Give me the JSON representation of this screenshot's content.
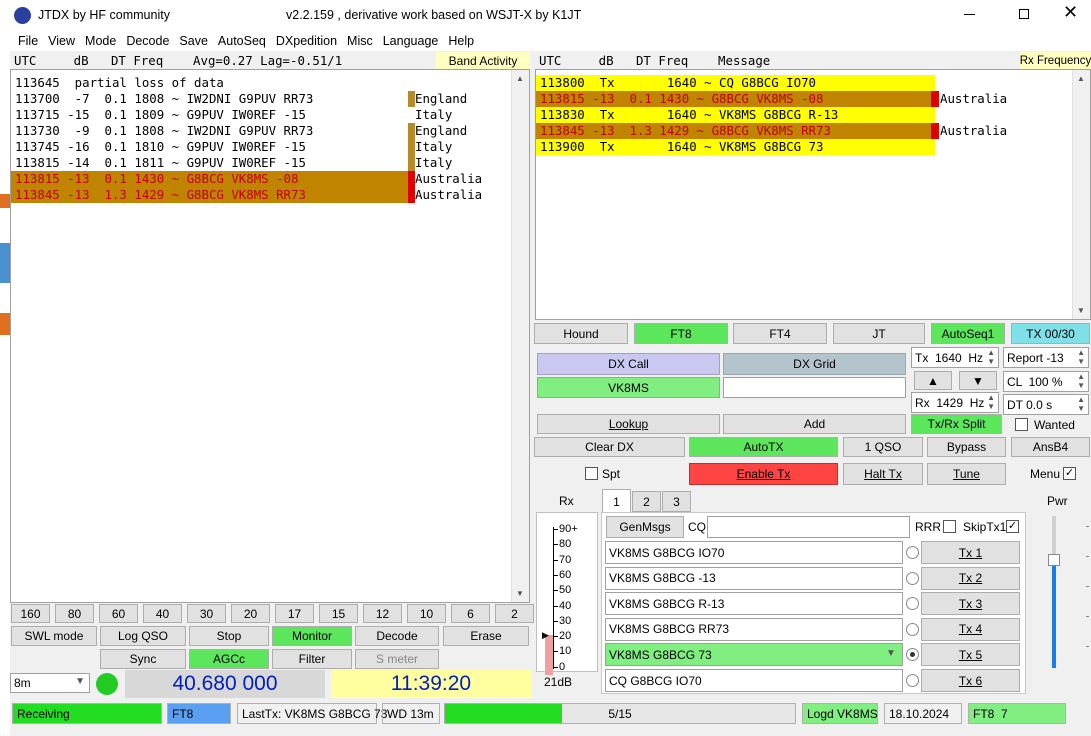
{
  "window": {
    "app_title": "JTDX  by HF community",
    "subtitle": "v2.2.159 , derivative work based on WSJT-X by K1JT"
  },
  "menu": [
    "File",
    "View",
    "Mode",
    "Decode",
    "Save",
    "AutoSeq",
    "DXpedition",
    "Misc",
    "Language",
    "Help"
  ],
  "band_activity": {
    "header": "UTC     dB   DT Freq    Avg=0.27 Lag=-0.51/1",
    "title": "Band Activity",
    "rows": [
      {
        "text": "113645  partial loss of data",
        "country": "",
        "style": "normal"
      },
      {
        "text": "113700  -7  0.1 1808 ~ IW2DNI G9PUV RR73",
        "country": "England",
        "style": "flag"
      },
      {
        "text": "113715 -15  0.1 1809 ~ G9PUV IW0REF -15",
        "country": "Italy",
        "style": "normal"
      },
      {
        "text": "113730  -9  0.1 1808 ~ IW2DNI G9PUV RR73",
        "country": "England",
        "style": "flag"
      },
      {
        "text": "113745 -16  0.1 1810 ~ G9PUV IW0REF -15",
        "country": "Italy",
        "style": "flag"
      },
      {
        "text": "113815 -14  0.1 1811 ~ G9PUV IW0REF -15",
        "country": "Italy",
        "style": "flag"
      },
      {
        "text": "113815 -13  0.1 1430 ~ G8BCG VK8MS -08",
        "country": "Australia",
        "style": "mine"
      },
      {
        "text": "113845 -13  1.3 1429 ~ G8BCG VK8MS RR73",
        "country": "Australia",
        "style": "mine"
      }
    ]
  },
  "rx_frequency": {
    "header": "UTC     dB   DT Freq    Message",
    "title": "Rx Frequency",
    "rows": [
      {
        "text": "113800  Tx       1640 ~ CQ G8BCG IO70",
        "country": "",
        "style": "tx"
      },
      {
        "text": "113815 -13  0.1 1430 ~ G8BCG VK8MS -08",
        "country": "Australia",
        "style": "mine"
      },
      {
        "text": "113830  Tx       1640 ~ VK8MS G8BCG R-13",
        "country": "",
        "style": "tx"
      },
      {
        "text": "113845 -13  1.3 1429 ~ G8BCG VK8MS RR73",
        "country": "Australia",
        "style": "mine"
      },
      {
        "text": "113900  Tx       1640 ~ VK8MS G8BCG 73",
        "country": "",
        "style": "tx"
      }
    ]
  },
  "bands": [
    "160",
    "80",
    "60",
    "40",
    "30",
    "20",
    "17",
    "15",
    "12",
    "10",
    "6",
    "2"
  ],
  "controls_row1": [
    "SWL mode",
    "Log QSO",
    "Stop",
    "Monitor",
    "Decode",
    "Erase"
  ],
  "controls_row2": [
    "Sync",
    "AGCc",
    "Filter",
    "S meter"
  ],
  "band_select": "8m",
  "frequency": "40.680 000",
  "clock": "11:39:20",
  "mode_buttons": [
    "Hound",
    "FT8",
    "FT4",
    "JT",
    "AutoSeq1",
    "TX 00/30"
  ],
  "dx": {
    "call_label": "DX Call",
    "grid_label": "DX Grid",
    "call": "VK8MS",
    "grid": "",
    "lookup": "Lookup",
    "add": "Add"
  },
  "tx_hz": "Tx  1640  Hz",
  "rx_hz": "Rx  1429  Hz",
  "report": "Report -13",
  "cl": "CL  100 %",
  "dt": "DT 0.0 s",
  "txrx_split": "Tx/Rx Split",
  "wanted": "Wanted",
  "row_buttons": [
    "Clear DX",
    "AutoTX",
    "1 QSO",
    "Bypass",
    "AnsB4"
  ],
  "spt": "Spt",
  "enable_tx": "Enable Tx",
  "halt_tx": "Halt Tx",
  "tune": "Tune",
  "menu_label": "Menu",
  "rx_label": "Rx",
  "pwr_label": "Pwr",
  "tabs": [
    "1",
    "2",
    "3"
  ],
  "genmsgs": "GenMsgs",
  "cq_label": "CQ",
  "rrr_label": "RRR",
  "skiptx1": "SkipTx1",
  "messages": [
    {
      "text": "VK8MS G8BCG IO70",
      "button": "Tx 1"
    },
    {
      "text": "VK8MS G8BCG -13",
      "button": "Tx 2"
    },
    {
      "text": "VK8MS G8BCG R-13",
      "button": "Tx 3"
    },
    {
      "text": "VK8MS G8BCG RR73",
      "button": "Tx 4"
    },
    {
      "text": "VK8MS G8BCG 73",
      "button": "Tx 5"
    },
    {
      "text": "CQ G8BCG IO70",
      "button": "Tx 6"
    }
  ],
  "meter": {
    "ticks": [
      "90+",
      "80",
      "70",
      "60",
      "50",
      "40",
      "30",
      "20",
      "10",
      "0"
    ],
    "reading": "21dB",
    "level_db": 21
  },
  "status": {
    "receiving": "Receiving",
    "mode": "FT8",
    "last_tx": "LastTx: VK8MS G8BCG 73",
    "wd": "WD 13m",
    "progress_text": "5/15",
    "progress_fraction": 0.333,
    "logd": "Logd VK8MS",
    "date": "18.10.2024",
    "ft8": "FT8  7"
  },
  "colors": {
    "tx_bg": "#ffff00",
    "mine_bg": "#c08400",
    "mine_fg": "#c00000",
    "flag": "#b88a2a",
    "green": "#5ce65c",
    "freq_blue": "#0020c0"
  }
}
